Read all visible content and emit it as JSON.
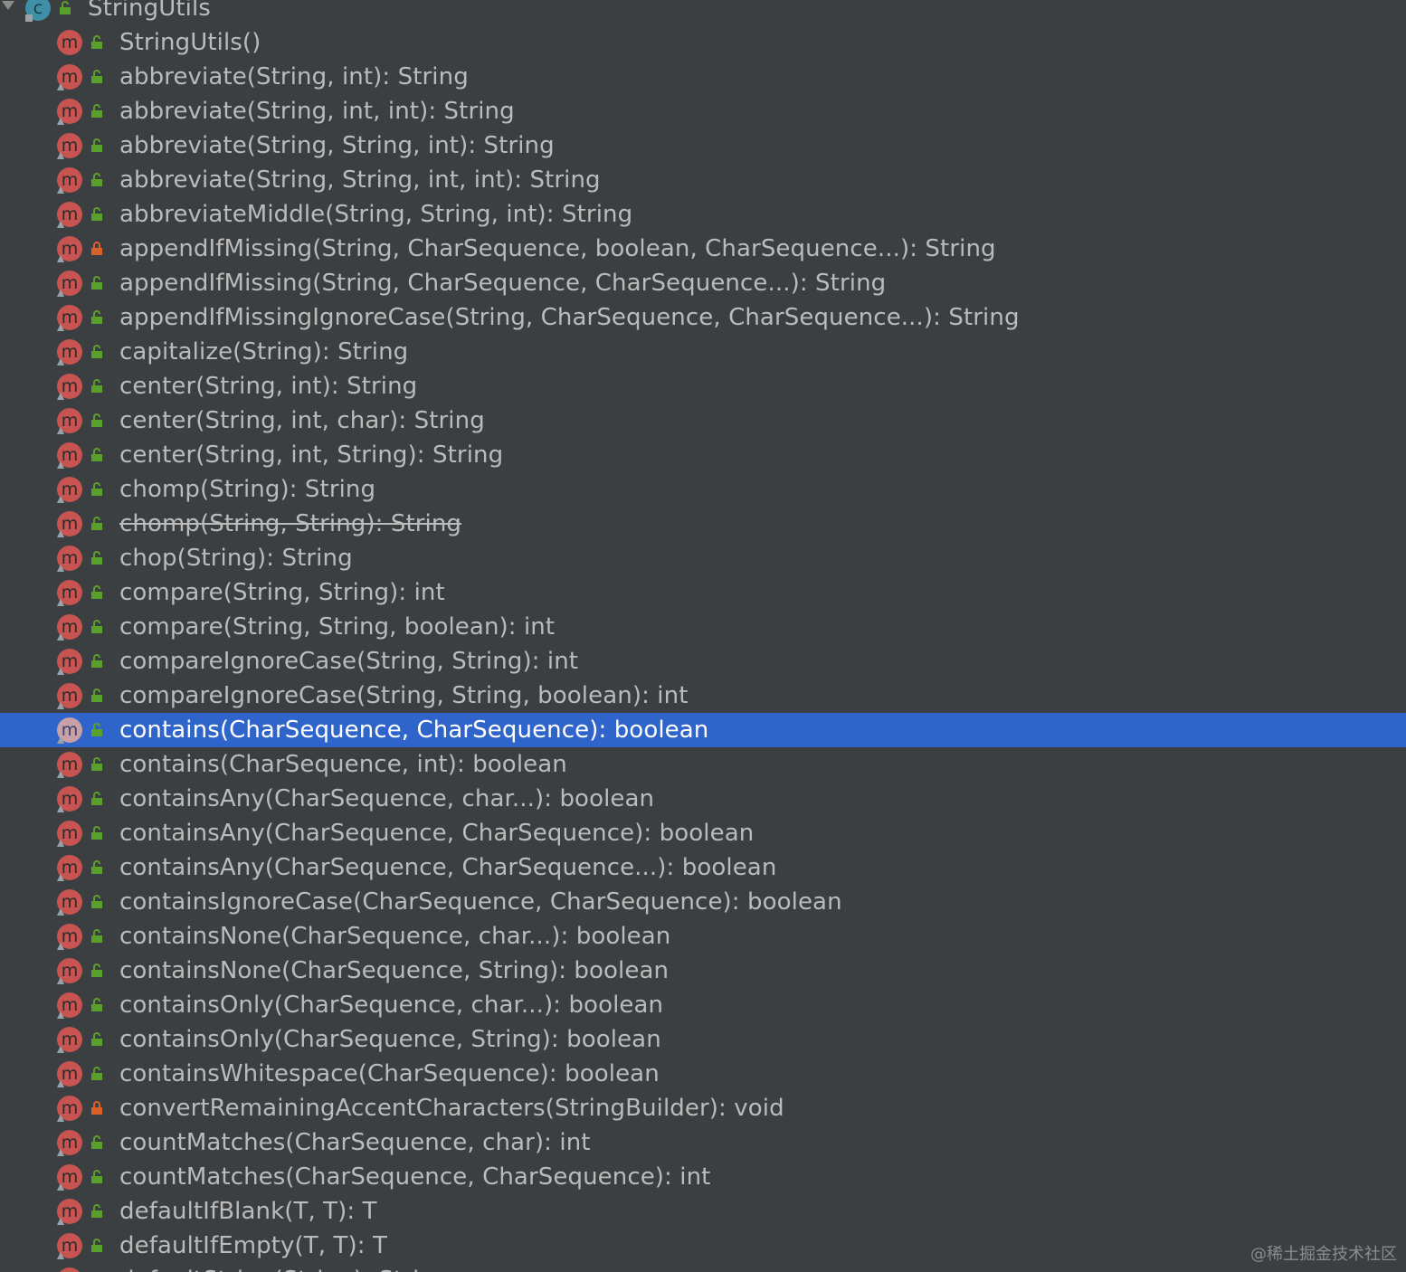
{
  "tree": {
    "root": {
      "label": "StringUtils",
      "icon": "class-icon"
    },
    "members": [
      {
        "label": "StringUtils()",
        "visibility": "public"
      },
      {
        "label": "abbreviate(String, int): String",
        "visibility": "public"
      },
      {
        "label": "abbreviate(String, int, int): String",
        "visibility": "public"
      },
      {
        "label": "abbreviate(String, String, int): String",
        "visibility": "public"
      },
      {
        "label": "abbreviate(String, String, int, int): String",
        "visibility": "public"
      },
      {
        "label": "abbreviateMiddle(String, String, int): String",
        "visibility": "public"
      },
      {
        "label": "appendIfMissing(String, CharSequence, boolean, CharSequence...): String",
        "visibility": "private"
      },
      {
        "label": "appendIfMissing(String, CharSequence, CharSequence...): String",
        "visibility": "public"
      },
      {
        "label": "appendIfMissingIgnoreCase(String, CharSequence, CharSequence...): String",
        "visibility": "public"
      },
      {
        "label": "capitalize(String): String",
        "visibility": "public"
      },
      {
        "label": "center(String, int): String",
        "visibility": "public"
      },
      {
        "label": "center(String, int, char): String",
        "visibility": "public"
      },
      {
        "label": "center(String, int, String): String",
        "visibility": "public"
      },
      {
        "label": "chomp(String): String",
        "visibility": "public"
      },
      {
        "label": "chomp(String, String): String",
        "visibility": "public",
        "deprecated": true
      },
      {
        "label": "chop(String): String",
        "visibility": "public"
      },
      {
        "label": "compare(String, String): int",
        "visibility": "public"
      },
      {
        "label": "compare(String, String, boolean): int",
        "visibility": "public"
      },
      {
        "label": "compareIgnoreCase(String, String): int",
        "visibility": "public"
      },
      {
        "label": "compareIgnoreCase(String, String, boolean): int",
        "visibility": "public"
      },
      {
        "label": "contains(CharSequence, CharSequence): boolean",
        "visibility": "public",
        "selected": true
      },
      {
        "label": "contains(CharSequence, int): boolean",
        "visibility": "public"
      },
      {
        "label": "containsAny(CharSequence, char...): boolean",
        "visibility": "public"
      },
      {
        "label": "containsAny(CharSequence, CharSequence): boolean",
        "visibility": "public"
      },
      {
        "label": "containsAny(CharSequence, CharSequence...): boolean",
        "visibility": "public"
      },
      {
        "label": "containsIgnoreCase(CharSequence, CharSequence): boolean",
        "visibility": "public"
      },
      {
        "label": "containsNone(CharSequence, char...): boolean",
        "visibility": "public"
      },
      {
        "label": "containsNone(CharSequence, String): boolean",
        "visibility": "public"
      },
      {
        "label": "containsOnly(CharSequence, char...): boolean",
        "visibility": "public"
      },
      {
        "label": "containsOnly(CharSequence, String): boolean",
        "visibility": "public"
      },
      {
        "label": "containsWhitespace(CharSequence): boolean",
        "visibility": "public"
      },
      {
        "label": "convertRemainingAccentCharacters(StringBuilder): void",
        "visibility": "private"
      },
      {
        "label": "countMatches(CharSequence, char): int",
        "visibility": "public"
      },
      {
        "label": "countMatches(CharSequence, CharSequence): int",
        "visibility": "public"
      },
      {
        "label": "defaultIfBlank(T, T): T",
        "visibility": "public"
      },
      {
        "label": "defaultIfEmpty(T, T): T",
        "visibility": "public"
      },
      {
        "label": "defaultString(String): String",
        "visibility": "public"
      }
    ]
  },
  "icons": {
    "class_letter": "c",
    "method_letter": "m"
  },
  "colors": {
    "background": "#3c3f41",
    "selection": "#2f65ca",
    "text": "#bbbbbb",
    "method_icon": "#c75450",
    "class_icon": "#3f8fa6",
    "public_visibility": "#5aa02c",
    "private_visibility": "#d9622b"
  },
  "watermark": "@稀土掘金技术社区"
}
